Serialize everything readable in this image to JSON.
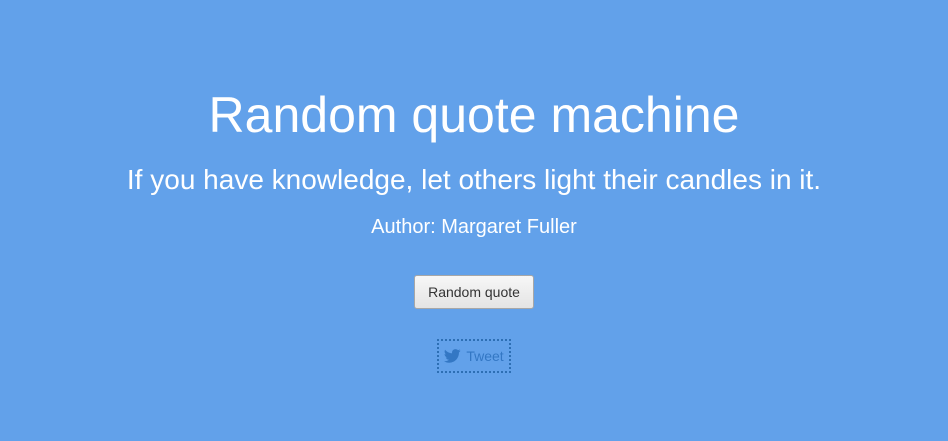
{
  "title": "Random quote machine",
  "quote": {
    "text": "If you have knowledge, let others light their candles in it.",
    "author": "Author: Margaret Fuller"
  },
  "actions": {
    "random_label": "Random quote",
    "tweet_label": "Tweet",
    "tweet_icon": "twitter-bird-icon"
  },
  "colors": {
    "background": "#62a1ea",
    "text": "#ffffff",
    "tweet_link": "#3377c4"
  }
}
